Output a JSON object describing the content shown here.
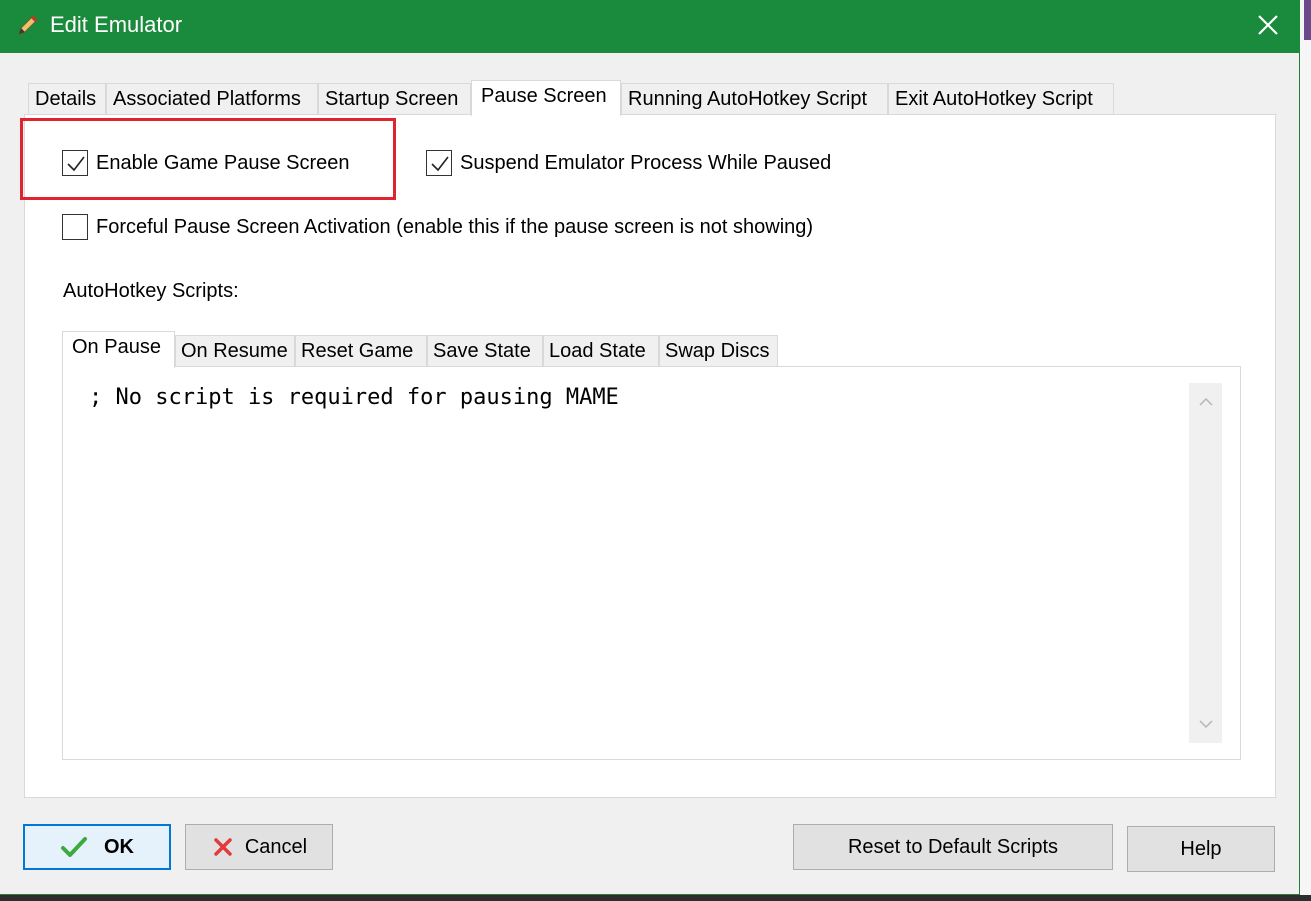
{
  "window": {
    "title": "Edit Emulator",
    "title_icon": "pencil-icon",
    "accent_color": "#1a8a3c"
  },
  "tabs": [
    {
      "label": "Details",
      "active": false
    },
    {
      "label": "Associated Platforms",
      "active": false
    },
    {
      "label": "Startup Screen",
      "active": false
    },
    {
      "label": "Pause Screen",
      "active": true
    },
    {
      "label": "Running AutoHotkey Script",
      "active": false
    },
    {
      "label": "Exit AutoHotkey Script",
      "active": false
    }
  ],
  "options": {
    "enable_pause": {
      "label": "Enable Game Pause Screen",
      "checked": true
    },
    "suspend_process": {
      "label": "Suspend Emulator Process While Paused",
      "checked": true
    },
    "forceful_activation": {
      "label": "Forceful Pause Screen Activation (enable this if the pause screen is not showing)",
      "checked": false
    }
  },
  "highlight_color": "#e0242f",
  "scripts": {
    "label": "AutoHotkey Scripts:",
    "tabs": [
      {
        "label": "On Pause",
        "active": true
      },
      {
        "label": "On Resume",
        "active": false
      },
      {
        "label": "Reset Game",
        "active": false
      },
      {
        "label": "Save State",
        "active": false
      },
      {
        "label": "Load State",
        "active": false
      },
      {
        "label": "Swap Discs",
        "active": false
      }
    ],
    "content": "; No script is required for pausing MAME"
  },
  "buttons": {
    "ok": {
      "label": "OK",
      "icon": "checkmark-icon"
    },
    "cancel": {
      "label": "Cancel",
      "icon": "x-icon"
    },
    "reset": {
      "label": "Reset to Default Scripts"
    },
    "help": {
      "label": "Help"
    }
  }
}
